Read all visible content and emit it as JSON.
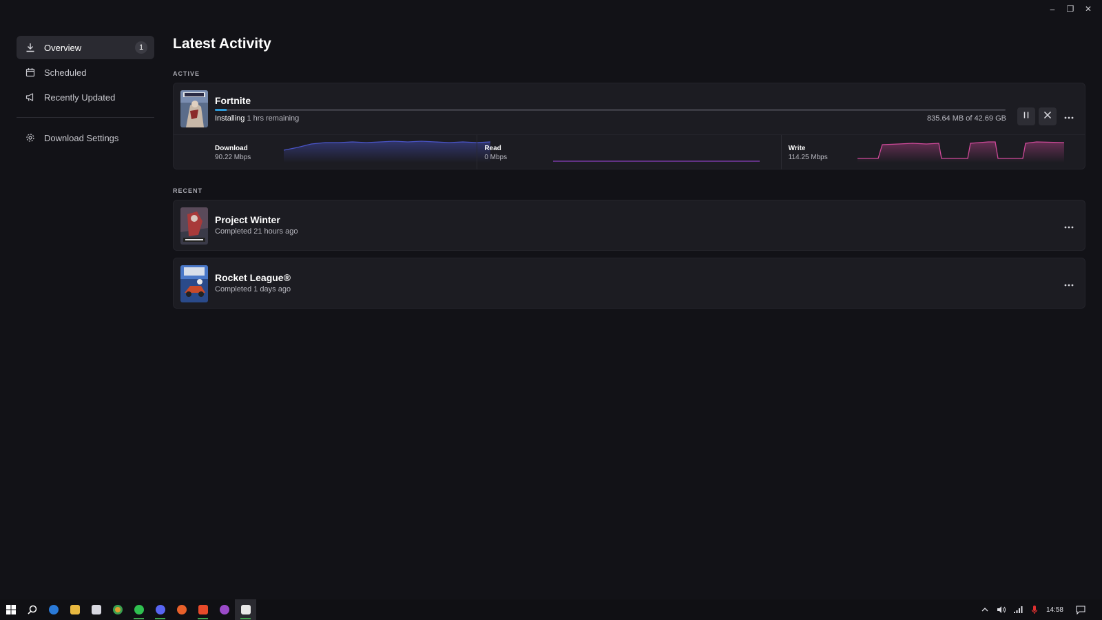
{
  "window": {
    "controls": {
      "minimize": "–",
      "restore": "❐",
      "close": "✕"
    }
  },
  "sidebar": {
    "items": [
      {
        "label": "Overview",
        "icon": "download-icon",
        "badge": "1",
        "active": true
      },
      {
        "label": "Scheduled",
        "icon": "calendar-icon"
      },
      {
        "label": "Recently Updated",
        "icon": "megaphone-icon"
      }
    ],
    "settings": {
      "label": "Download Settings",
      "icon": "gear-icon"
    }
  },
  "main": {
    "title": "Latest Activity",
    "active_label": "ACTIVE",
    "recent_label": "RECENT",
    "active": {
      "name": "Fortnite",
      "status": "Installing",
      "remaining": "1 hrs remaining",
      "size": "835.64 MB of 42.69 GB",
      "progress": 0.015,
      "stats": [
        {
          "label": "Download",
          "value": "90.22 Mbps",
          "color": "#4a55c8"
        },
        {
          "label": "Read",
          "value": "0 Mbps",
          "color": "#8a3fc0"
        },
        {
          "label": "Write",
          "value": "114.25 Mbps",
          "color": "#d04a9a"
        }
      ]
    },
    "recent": [
      {
        "name": "Project Winter",
        "status": "Completed 21 hours ago"
      },
      {
        "name": "Rocket League®",
        "status": "Completed 1 days ago"
      }
    ]
  },
  "taskbar": {
    "apps": [
      "windows-start-icon",
      "search-icon",
      "edge-icon",
      "file-explorer-icon",
      "store-icon",
      "chrome-icon",
      "whatsapp-icon",
      "discord-icon",
      "firefox-icon",
      "brave-icon",
      "tor-icon",
      "epic-games-icon"
    ],
    "clock": "14:58"
  },
  "colors": {
    "accent": "#2f9bd8",
    "background": "#121217",
    "card": "#1c1c22",
    "running_indicator": "#3fa34d"
  }
}
